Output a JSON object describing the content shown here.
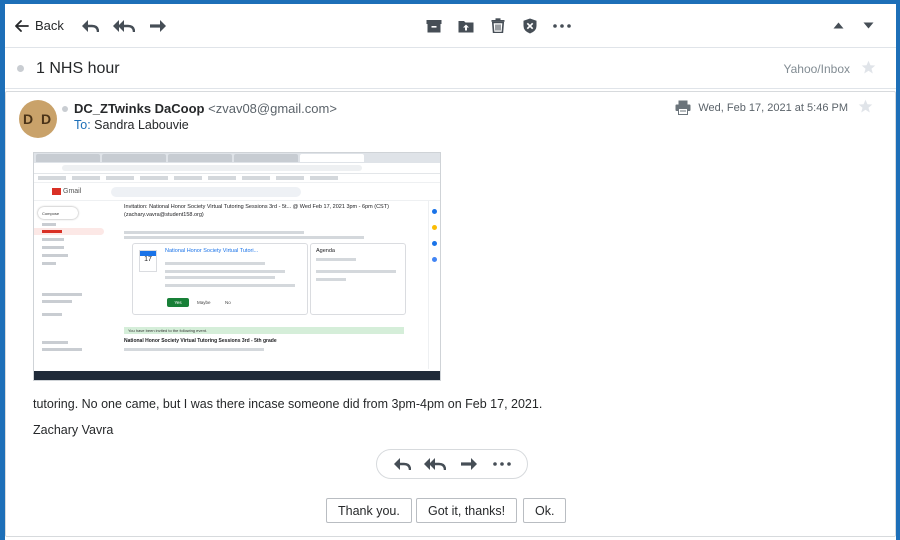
{
  "toolbar": {
    "back_label": "Back",
    "icons": [
      "reply-icon",
      "reply-all-icon",
      "forward-icon",
      "archive-icon",
      "move-icon",
      "delete-icon",
      "spam-icon",
      "more-icon",
      "previous-icon",
      "next-icon"
    ]
  },
  "message": {
    "subject": "1 NHS hour",
    "folder": "Yahoo/Inbox",
    "sender": {
      "initials": "D D",
      "name": "DC_ZTwinks DaCoop",
      "email": "<zvav08@gmail.com>"
    },
    "to_label": "To:",
    "recipient": "Sandra Labouvie",
    "date": "Wed, Feb 17, 2021 at 5:46 PM",
    "body": "tutoring. No one came, but I was there incase someone did from 3pm-4pm on Feb 17, 2021.",
    "signature": "Zachary Vavra"
  },
  "attachment_screenshot": {
    "app": "Gmail",
    "compose_label": "Compose",
    "invitation_title": "Invitation: National Honor Society Virtual Tutoring Sessions 3rd - 5t... @ Wed Feb 17, 2021 3pm - 6pm (CST) (zachary.vavra@student158.org)",
    "event_title": "National Honor Society Virtual Tutori...",
    "calendar_day": "17",
    "agenda_label": "Agenda",
    "yes_label": "Yes",
    "maybe_label": "Maybe",
    "no_label": "No",
    "invited_banner": "You have been invited to the following event.",
    "event_full_title": "National Honor Society Virtual Tutoring Sessions 3rd - 5th grade"
  },
  "quick_replies": [
    "Thank you.",
    "Got it, thanks!",
    "Ok."
  ],
  "colors": {
    "accent": "#1d6fb8",
    "text": "#26282a",
    "muted": "#828c93",
    "icon": "#464e56"
  }
}
